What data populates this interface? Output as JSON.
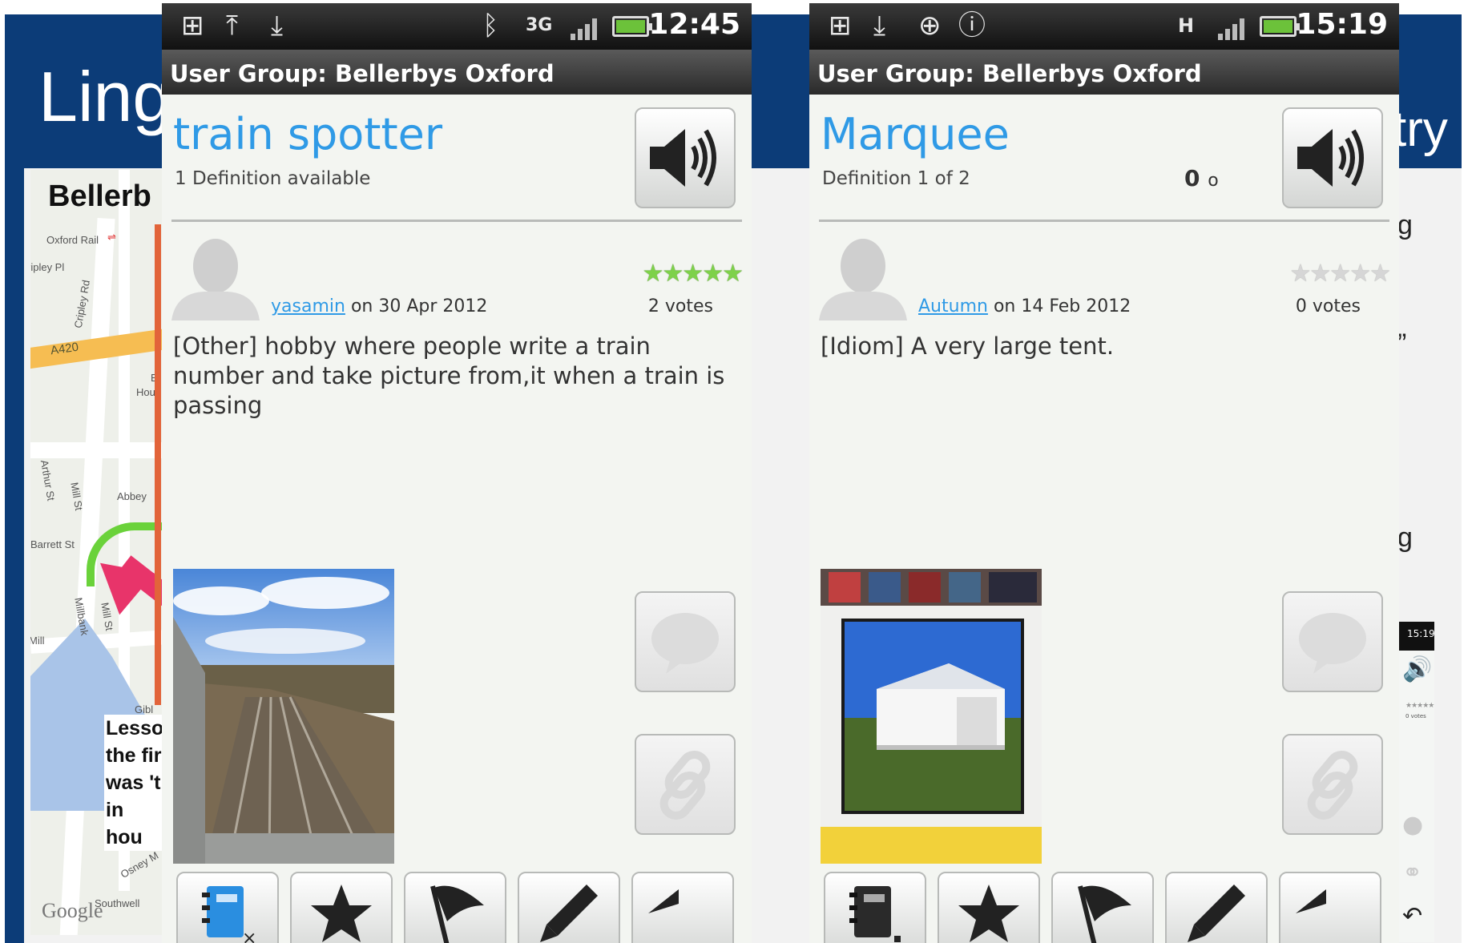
{
  "slide": {
    "title_left": "Ling",
    "title_right": "try",
    "right_fragments": [
      "g",
      "”",
      "g"
    ],
    "mini_time": "15:19",
    "mini_votes": "0 votes"
  },
  "map": {
    "title": "Bellerb",
    "road_labels": [
      "Oxford Rail",
      "ripley Pl",
      "Cripley Rd",
      "A420",
      "Hou",
      "E",
      "Arthur St",
      "Mill St",
      "Abbey",
      "Barrett St",
      "Millbank",
      "Mill St",
      "Mill",
      "Gibl",
      "Osney M",
      "Southwell"
    ],
    "lesson_lines": [
      "Lesso",
      "the fir",
      "was 't",
      "in hou"
    ],
    "google_label": "Google"
  },
  "phones": [
    {
      "status_time": "12:45",
      "network": "3G",
      "title_bar": "User Group: Bellerbys Oxford",
      "word": "train spotter",
      "definition_count": "1 Definition available",
      "author": "yasamin",
      "date": "on 30 Apr 2012",
      "votes": "2 votes",
      "rating_stars": 5,
      "definition": "[Other] hobby where people write  a train number and take picture from,it when a train is passing"
    },
    {
      "status_time": "15:19",
      "network": "H",
      "title_bar": "User Group: Bellerbys Oxford",
      "word": "Marquee",
      "definition_count": "Definition 1 of 2",
      "counter_big": "0",
      "counter_small": "o",
      "author": "Autumn",
      "date": "on 14 Feb 2012",
      "votes": "0 votes",
      "rating_stars": 0,
      "definition": "[Idiom] A very large tent."
    }
  ],
  "icons": {
    "speaker": "speaker-icon",
    "comment": "comment-bubble-icon",
    "link": "link-chain-icon",
    "notebook": "notebook-icon",
    "star": "star-icon",
    "flag": "flag-icon",
    "pencil": "pencil-icon",
    "back": "back-arrow-icon"
  },
  "colors": {
    "accent_blue": "#2f9ae6",
    "slide_blue": "#0c3c78",
    "star_green": "#7ed14a"
  }
}
